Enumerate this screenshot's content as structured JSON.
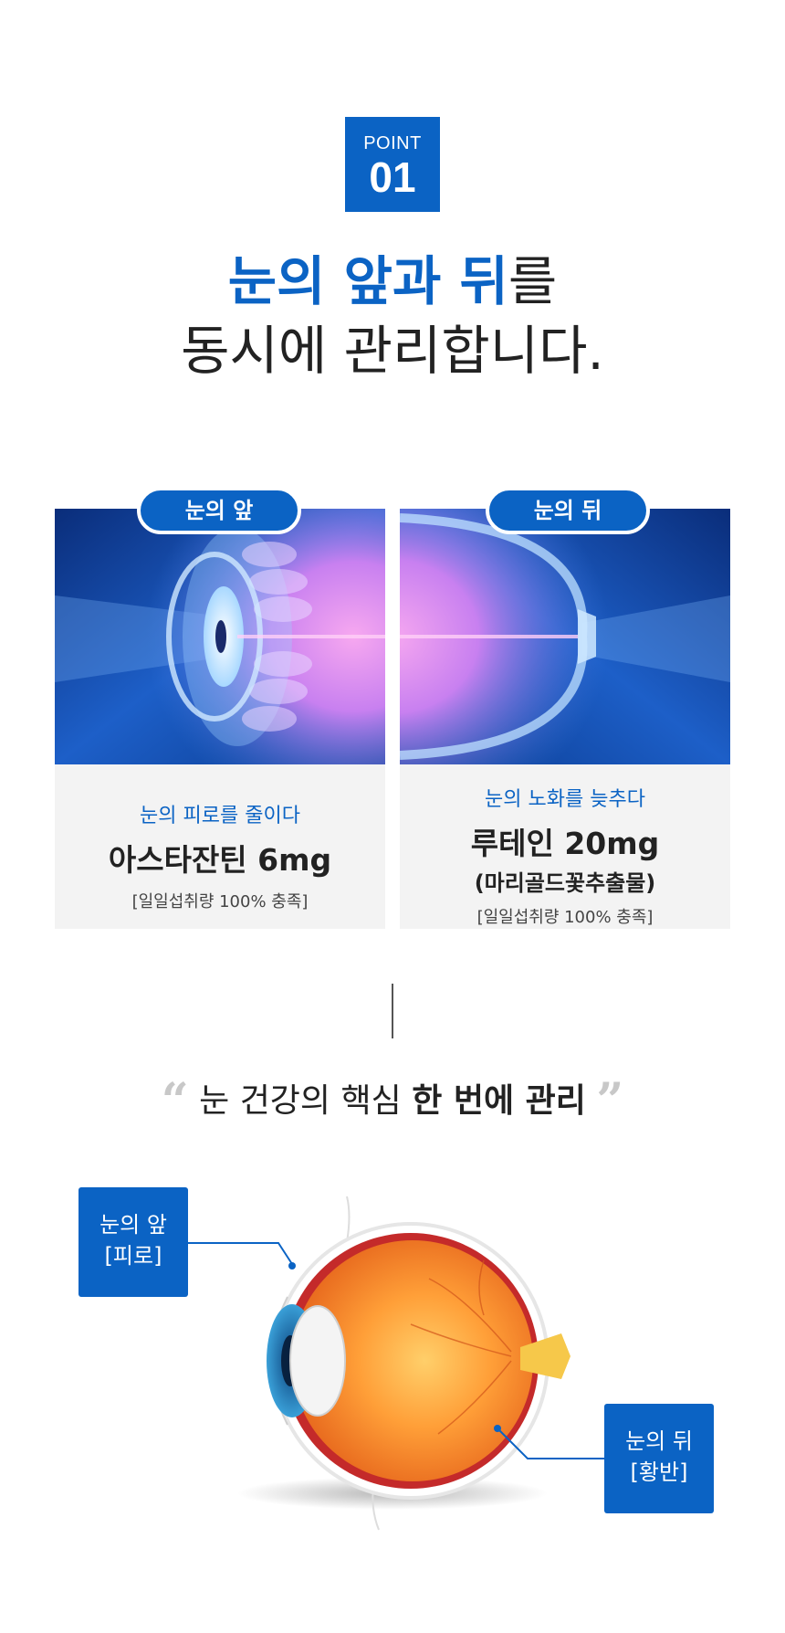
{
  "point": {
    "label": "POINT",
    "number": "01"
  },
  "headline": {
    "line1_blue1": "눈의 앞",
    "line1_mid": "과 ",
    "line1_blue2": "뒤",
    "line1_end": "를",
    "line2": "동시에 관리합니다."
  },
  "cards": [
    {
      "tag": "눈의 앞",
      "sub": "눈의 피로를 줄이다",
      "main": "아스타잔틴 6mg",
      "paren": "",
      "note": "[일일섭취량 100% 충족]"
    },
    {
      "tag": "눈의 뒤",
      "sub": "눈의 노화를 늦추다",
      "main": "루테인 20mg",
      "paren": "(마리골드꽃추출물)",
      "note": "[일일섭취량 100% 충족]"
    }
  ],
  "quote": {
    "open": "“",
    "normal": "눈 건강의 핵심 ",
    "bold": "한 번에 관리",
    "close": "”"
  },
  "labels": {
    "front_line1": "눈의 앞",
    "front_line2": "[피로]",
    "back_line1": "눈의 뒤",
    "back_line2": "[황반]"
  },
  "colors": {
    "accent": "#0b63c4",
    "card_bg": "#f3f3f3",
    "quote_mark": "#c8c8c8"
  }
}
